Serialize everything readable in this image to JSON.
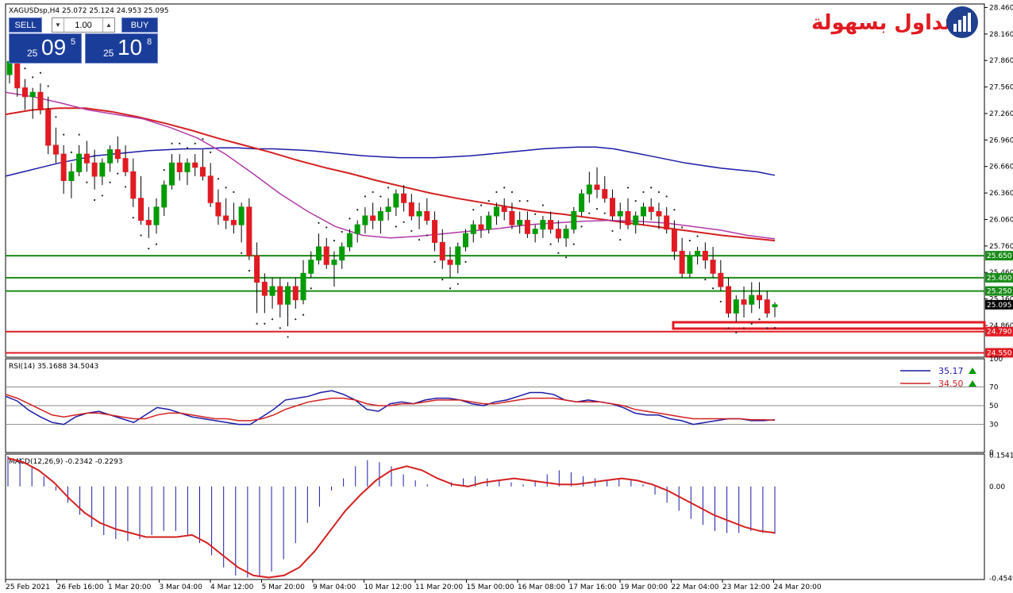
{
  "header": {
    "symbol_info": "XAGUSDsp,H4  25.072 25.124 24.953 25.095",
    "rsi_label": "RSI(14) 35.1688 34.5043",
    "macd_label": "MACD(12,26,9) -0.2342 -0.2293"
  },
  "trade_panel": {
    "sell_label": "SELL",
    "buy_label": "BUY",
    "lot_value": "1.00",
    "sell_price_prefix": "25",
    "sell_price_big": "09",
    "sell_price_sup": "5",
    "buy_price_prefix": "25",
    "buy_price_big": "10",
    "buy_price_sup": "8"
  },
  "logo": {
    "text": "التداول بسهولة",
    "icon": "chart-logo-icon"
  },
  "colors": {
    "bull": "#009b00",
    "bear": "#e11b22",
    "ma_blue": "#1a1aa6",
    "ma_red": "#d42020",
    "ma_purple": "#b23aa8",
    "level_green": "#1a8c1a",
    "level_red": "#e11b22",
    "rsi_line": "#1a1aa6",
    "rsi_signal": "#d42020",
    "macd_hist": "#1a1aa6",
    "macd_signal": "#d42020"
  },
  "chart_data": [
    {
      "type": "candlestick",
      "title": "XAGUSDsp,H4",
      "ylim": [
        24.5,
        28.5
      ],
      "y_ticks": [
        "28.460",
        "28.160",
        "27.860",
        "27.560",
        "27.260",
        "26.960",
        "26.660",
        "26.360",
        "26.060",
        "25.760",
        "25.460",
        "25.160",
        "24.860"
      ],
      "x_ticks": [
        "25 Feb 2021",
        "26 Feb 16:00",
        "1 Mar 20:00",
        "3 Mar 04:00",
        "4 Mar 12:00",
        "5 Mar 20:00",
        "9 Mar 04:00",
        "10 Mar 12:00",
        "11 Mar 20:00",
        "15 Mar 00:00",
        "16 Mar 08:00",
        "17 Mar 16:00",
        "19 Mar 00:00",
        "22 Mar 04:00",
        "23 Mar 12:00",
        "24 Mar 20:00"
      ],
      "horizontal_levels": [
        {
          "value": 25.65,
          "label": "25.650",
          "color": "green"
        },
        {
          "value": 25.4,
          "label": "25.400",
          "color": "green"
        },
        {
          "value": 25.25,
          "label": "25.250",
          "color": "green"
        },
        {
          "value": 24.79,
          "label": "24.790",
          "color": "red"
        },
        {
          "value": 24.55,
          "label": "24.550",
          "color": "red"
        }
      ],
      "current_price": "25.095",
      "ohlc": [
        [
          27.7,
          27.9,
          27.6,
          27.85
        ],
        [
          27.85,
          27.9,
          27.45,
          27.55
        ],
        [
          27.55,
          27.65,
          27.3,
          27.45
        ],
        [
          27.45,
          27.55,
          27.2,
          27.5
        ],
        [
          27.5,
          27.6,
          27.25,
          27.3
        ],
        [
          27.3,
          27.45,
          26.8,
          26.9
        ],
        [
          26.9,
          27.1,
          26.7,
          26.8
        ],
        [
          26.8,
          26.9,
          26.35,
          26.5
        ],
        [
          26.5,
          26.7,
          26.3,
          26.6
        ],
        [
          26.6,
          26.9,
          26.55,
          26.8
        ],
        [
          26.8,
          26.95,
          26.6,
          26.7
        ],
        [
          26.7,
          26.85,
          26.4,
          26.55
        ],
        [
          26.55,
          26.75,
          26.45,
          26.7
        ],
        [
          26.7,
          26.9,
          26.6,
          26.85
        ],
        [
          26.85,
          27.0,
          26.7,
          26.75
        ],
        [
          26.75,
          26.9,
          26.55,
          26.6
        ],
        [
          26.6,
          26.75,
          26.2,
          26.3
        ],
        [
          26.3,
          26.55,
          26.0,
          26.05
        ],
        [
          26.05,
          26.2,
          25.85,
          26.0
        ],
        [
          26.0,
          26.3,
          25.9,
          26.2
        ],
        [
          26.2,
          26.5,
          26.1,
          26.45
        ],
        [
          26.45,
          26.8,
          26.4,
          26.7
        ],
        [
          26.7,
          26.8,
          26.5,
          26.6
        ],
        [
          26.6,
          26.75,
          26.45,
          26.7
        ],
        [
          26.7,
          26.8,
          26.55,
          26.65
        ],
        [
          26.65,
          26.85,
          26.5,
          26.55
        ],
        [
          26.55,
          26.7,
          26.2,
          26.25
        ],
        [
          26.25,
          26.4,
          26.0,
          26.1
        ],
        [
          26.1,
          26.3,
          25.95,
          26.05
        ],
        [
          26.05,
          26.25,
          25.9,
          26.0
        ],
        [
          26.0,
          26.25,
          25.8,
          26.2
        ],
        [
          26.2,
          26.3,
          25.6,
          25.65
        ],
        [
          25.65,
          25.8,
          25.0,
          25.35
        ],
        [
          25.35,
          25.45,
          25.0,
          25.2
        ],
        [
          25.2,
          25.4,
          25.05,
          25.3
        ],
        [
          25.3,
          25.4,
          24.95,
          25.1
        ],
        [
          25.1,
          25.35,
          24.85,
          25.3
        ],
        [
          25.3,
          25.4,
          25.05,
          25.15
        ],
        [
          25.15,
          25.6,
          25.1,
          25.45
        ],
        [
          25.45,
          25.7,
          25.4,
          25.6
        ],
        [
          25.6,
          25.9,
          25.55,
          25.75
        ],
        [
          25.75,
          25.85,
          25.5,
          25.55
        ],
        [
          25.55,
          25.7,
          25.3,
          25.6
        ],
        [
          25.6,
          25.8,
          25.5,
          25.75
        ],
        [
          25.75,
          25.95,
          25.7,
          25.9
        ],
        [
          25.9,
          26.05,
          25.8,
          26.0
        ],
        [
          26.0,
          26.2,
          25.9,
          26.1
        ],
        [
          26.1,
          26.25,
          25.95,
          26.05
        ],
        [
          26.05,
          26.2,
          25.9,
          26.15
        ],
        [
          26.15,
          26.3,
          26.05,
          26.2
        ],
        [
          26.2,
          26.4,
          26.1,
          26.35
        ],
        [
          26.35,
          26.45,
          26.15,
          26.25
        ],
        [
          26.25,
          26.35,
          26.05,
          26.1
        ],
        [
          26.1,
          26.25,
          25.95,
          26.15
        ],
        [
          26.15,
          26.3,
          26.0,
          26.05
        ],
        [
          26.05,
          26.15,
          25.7,
          25.8
        ],
        [
          25.8,
          25.95,
          25.5,
          25.6
        ],
        [
          25.6,
          25.75,
          25.4,
          25.55
        ],
        [
          25.55,
          25.8,
          25.45,
          25.75
        ],
        [
          25.75,
          25.95,
          25.7,
          25.9
        ],
        [
          25.9,
          26.05,
          25.8,
          26.0
        ],
        [
          26.0,
          26.1,
          25.85,
          25.95
        ],
        [
          25.95,
          26.15,
          25.9,
          26.1
        ],
        [
          26.1,
          26.25,
          26.0,
          26.2
        ],
        [
          26.2,
          26.3,
          26.05,
          26.15
        ],
        [
          26.15,
          26.25,
          25.95,
          26.0
        ],
        [
          26.0,
          26.15,
          25.9,
          26.05
        ],
        [
          26.05,
          26.15,
          25.85,
          25.9
        ],
        [
          25.9,
          26.0,
          25.8,
          25.95
        ],
        [
          25.95,
          26.1,
          25.85,
          26.05
        ],
        [
          26.05,
          26.15,
          25.9,
          25.95
        ],
        [
          25.95,
          26.05,
          25.8,
          25.85
        ],
        [
          25.85,
          26.0,
          25.75,
          25.95
        ],
        [
          25.95,
          26.2,
          25.9,
          26.15
        ],
        [
          26.15,
          26.4,
          26.1,
          26.35
        ],
        [
          26.35,
          26.6,
          26.25,
          26.45
        ],
        [
          26.45,
          26.65,
          26.3,
          26.4
        ],
        [
          26.4,
          26.55,
          26.25,
          26.3
        ],
        [
          26.3,
          26.4,
          26.05,
          26.1
        ],
        [
          26.1,
          26.25,
          25.95,
          26.15
        ],
        [
          26.15,
          26.3,
          25.95,
          26.0
        ],
        [
          26.0,
          26.15,
          25.9,
          26.1
        ],
        [
          26.1,
          26.25,
          26.0,
          26.2
        ],
        [
          26.2,
          26.3,
          26.05,
          26.15
        ],
        [
          26.15,
          26.25,
          25.95,
          26.1
        ],
        [
          26.1,
          26.2,
          25.9,
          25.95
        ],
        [
          25.95,
          26.05,
          25.6,
          25.7
        ],
        [
          25.7,
          25.85,
          25.4,
          25.45
        ],
        [
          25.45,
          25.7,
          25.4,
          25.65
        ],
        [
          25.65,
          25.75,
          25.55,
          25.7
        ],
        [
          25.7,
          25.8,
          25.5,
          25.6
        ],
        [
          25.6,
          25.75,
          25.4,
          25.45
        ],
        [
          25.45,
          25.6,
          25.25,
          25.3
        ],
        [
          25.3,
          25.4,
          24.95,
          25.0
        ],
        [
          25.0,
          25.2,
          24.9,
          25.15
        ],
        [
          25.15,
          25.3,
          24.95,
          25.1
        ],
        [
          25.1,
          25.35,
          25.0,
          25.2
        ],
        [
          25.2,
          25.35,
          25.05,
          25.15
        ],
        [
          25.15,
          25.25,
          24.95,
          25.0
        ],
        [
          25.072,
          25.124,
          24.953,
          25.095
        ]
      ],
      "series": [
        {
          "name": "MA blue",
          "values": [
            26.55,
            26.6,
            26.65,
            26.7,
            26.74,
            26.78,
            26.8,
            26.82,
            26.84,
            26.85,
            26.86,
            26.86,
            26.87,
            26.87,
            26.86,
            26.86,
            26.85,
            26.84,
            26.82,
            26.8,
            26.78,
            26.77,
            26.76,
            26.76,
            26.76,
            26.77,
            26.78,
            26.8,
            26.82,
            26.84,
            26.86,
            26.87,
            26.88,
            26.88,
            26.86,
            26.82,
            26.78,
            26.74,
            26.7,
            26.67,
            26.64,
            26.62,
            26.6,
            26.56
          ]
        },
        {
          "name": "MA red",
          "values": [
            27.25,
            27.3,
            27.32,
            27.32,
            27.28,
            27.22,
            27.15,
            27.07,
            26.98,
            26.9,
            26.82,
            26.73,
            26.65,
            26.58,
            26.5,
            26.43,
            26.36,
            26.3,
            26.25,
            26.2,
            26.15,
            26.12,
            26.08,
            26.04,
            26.0,
            25.96,
            25.92,
            25.88,
            25.85,
            25.82
          ]
        },
        {
          "name": "MA purple",
          "values": [
            27.5,
            27.45,
            27.38,
            27.3,
            27.25,
            27.2,
            27.1,
            26.98,
            26.8,
            26.58,
            26.35,
            26.15,
            25.98,
            25.88,
            25.85,
            25.87,
            25.9,
            25.93,
            25.96,
            26.0,
            26.02,
            26.04,
            26.05,
            26.04,
            26.02,
            25.98,
            25.94,
            25.88,
            25.84
          ]
        }
      ]
    },
    {
      "type": "line",
      "title": "RSI(14) 35.1688 34.5043",
      "ylim": [
        0,
        100
      ],
      "y_ticks": [
        "100",
        "70",
        "50",
        "30",
        "0"
      ],
      "legend": [
        "35.17",
        "34.50"
      ],
      "series": [
        {
          "name": "RSI",
          "values": [
            60,
            55,
            45,
            38,
            32,
            30,
            38,
            42,
            44,
            40,
            36,
            32,
            40,
            48,
            46,
            42,
            38,
            36,
            34,
            32,
            30,
            30,
            38,
            46,
            56,
            58,
            60,
            64,
            66,
            62,
            56,
            46,
            44,
            52,
            54,
            52,
            56,
            58,
            58,
            56,
            52,
            50,
            54,
            56,
            60,
            64,
            64,
            62,
            56,
            54,
            56,
            54,
            52,
            48,
            42,
            40,
            40,
            36,
            34,
            30,
            32,
            34,
            36,
            36,
            34,
            34,
            35
          ]
        },
        {
          "name": "Signal",
          "values": [
            62,
            58,
            52,
            46,
            40,
            38,
            40,
            42,
            42,
            40,
            38,
            36,
            36,
            40,
            42,
            42,
            40,
            38,
            36,
            36,
            34,
            34,
            36,
            40,
            46,
            50,
            54,
            56,
            58,
            58,
            56,
            52,
            50,
            50,
            52,
            52,
            54,
            56,
            56,
            56,
            54,
            52,
            52,
            54,
            56,
            58,
            58,
            58,
            56,
            54,
            54,
            54,
            52,
            50,
            46,
            44,
            42,
            40,
            38,
            36,
            36,
            36,
            36,
            36,
            35,
            35,
            34.5
          ]
        }
      ]
    },
    {
      "type": "bar",
      "title": "MACD(12,26,9) -0.2342 -0.2293",
      "ylim": [
        -0.46,
        0.16
      ],
      "y_ticks": [
        "0.1541",
        "0.00",
        "-0.4549"
      ],
      "series": [
        {
          "name": "MACD",
          "values": [
            0.15,
            0.14,
            0.1,
            0.05,
            -0.02,
            -0.08,
            -0.14,
            -0.2,
            -0.24,
            -0.26,
            -0.27,
            -0.26,
            -0.24,
            -0.22,
            -0.22,
            -0.24,
            -0.28,
            -0.34,
            -0.4,
            -0.44,
            -0.45,
            -0.44,
            -0.42,
            -0.36,
            -0.28,
            -0.18,
            -0.1,
            -0.02,
            0.04,
            0.1,
            0.13,
            0.12,
            0.1,
            0.06,
            0.03,
            0.01,
            0.0,
            0.02,
            0.04,
            0.05,
            0.04,
            0.03,
            0.02,
            0.01,
            0.03,
            0.06,
            0.08,
            0.07,
            0.05,
            0.04,
            0.03,
            0.04,
            0.03,
            0.01,
            -0.04,
            -0.08,
            -0.12,
            -0.16,
            -0.19,
            -0.22,
            -0.23,
            -0.23,
            -0.22,
            -0.23,
            -0.2342
          ]
        },
        {
          "name": "Signal",
          "values": [
            0.14,
            0.12,
            0.08,
            0.02,
            -0.06,
            -0.13,
            -0.18,
            -0.21,
            -0.23,
            -0.25,
            -0.25,
            -0.25,
            -0.24,
            -0.28,
            -0.34,
            -0.4,
            -0.44,
            -0.45,
            -0.44,
            -0.4,
            -0.32,
            -0.22,
            -0.12,
            -0.04,
            0.03,
            0.08,
            0.1,
            0.08,
            0.04,
            0.01,
            0.0,
            0.02,
            0.03,
            0.04,
            0.03,
            0.02,
            0.01,
            0.01,
            0.02,
            0.03,
            0.04,
            0.03,
            0.01,
            -0.02,
            -0.06,
            -0.1,
            -0.14,
            -0.17,
            -0.2,
            -0.22,
            -0.2293
          ]
        }
      ]
    }
  ]
}
